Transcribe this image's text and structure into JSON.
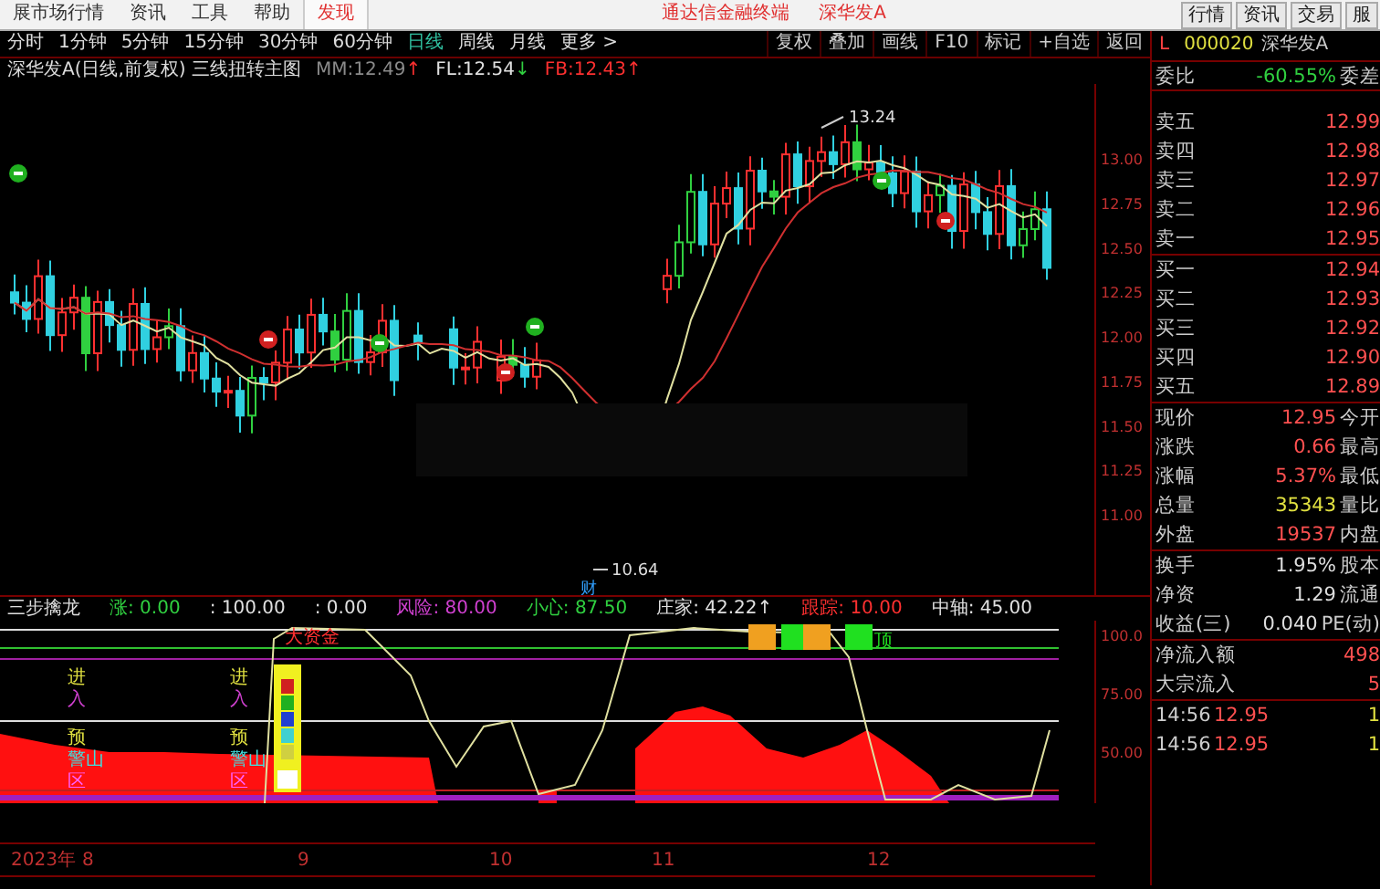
{
  "menu": {
    "items": [
      {
        "label": "展市场行情",
        "selected": false
      },
      {
        "label": "资讯",
        "selected": false
      },
      {
        "label": "工具",
        "selected": false
      },
      {
        "label": "帮助",
        "selected": false
      },
      {
        "label": "发现",
        "selected": true
      }
    ],
    "app_title": "通达信金融终端",
    "stock_title": "深华发A",
    "right_buttons": [
      "行情",
      "资讯",
      "交易",
      "服"
    ]
  },
  "periods": [
    {
      "label": "分时",
      "selected": false
    },
    {
      "label": "1分钟",
      "selected": false
    },
    {
      "label": "5分钟",
      "selected": false
    },
    {
      "label": "15分钟",
      "selected": false
    },
    {
      "label": "30分钟",
      "selected": false
    },
    {
      "label": "60分钟",
      "selected": false
    },
    {
      "label": "日线",
      "selected": true
    },
    {
      "label": "周线",
      "selected": false
    },
    {
      "label": "月线",
      "selected": false
    },
    {
      "label": "更多 >",
      "selected": false
    }
  ],
  "toolbar": [
    "复权",
    "叠加",
    "画线",
    "F10",
    "标记",
    "+自选",
    "返回"
  ],
  "main_chart": {
    "title": "深华发A(日线,前复权) 三线扭转主图",
    "indicators": [
      {
        "text": "MM:12.49",
        "arrow": "↑",
        "color": "#8a8a8a",
        "rising": true
      },
      {
        "text": "FL:12.54",
        "arrow": "↓",
        "color": "#e0e0e0",
        "rising": false
      },
      {
        "text": "FB:12.43",
        "arrow": "↑",
        "color": "#ff3030",
        "rising": true
      }
    ],
    "high_label": "13.24",
    "low_label": "10.64",
    "event_mark": "财",
    "price_axis": [
      "13.00",
      "12.75",
      "12.50",
      "12.25",
      "12.00",
      "11.75",
      "11.50",
      "11.25",
      "11.00"
    ]
  },
  "indicator": {
    "name": "三步擒龙",
    "values": [
      {
        "text": "涨: 0.00",
        "color": "#30d040"
      },
      {
        "text": ": 100.00",
        "color": "#e0e0e0"
      },
      {
        "text": ": 0.00",
        "color": "#e0e0e0"
      },
      {
        "text": "风险: 80.00",
        "color": "#d040d0"
      },
      {
        "text": "小心: 87.50",
        "color": "#30d040"
      },
      {
        "text": "庄家: 42.22↑",
        "color": "#e0e0e0"
      },
      {
        "text": "跟踪: 10.00",
        "color": "#ff3030"
      },
      {
        "text": "中轴: 45.00",
        "color": "#e0e0e0"
      }
    ],
    "signal_columns": [
      [
        {
          "text": "进",
          "color": "#e0e040"
        },
        {
          "text": "入",
          "color": "#d040d0"
        },
        {
          "text": "预",
          "color": "#e0e040"
        },
        {
          "text": "警山",
          "color": "#40e0e0"
        },
        {
          "text": "区",
          "color": "#ff60ff"
        }
      ],
      [
        {
          "text": "进",
          "color": "#e0e040"
        },
        {
          "text": "入",
          "color": "#d040d0"
        },
        {
          "text": "预",
          "color": "#e0e040"
        },
        {
          "text": "警山",
          "color": "#40e0e0"
        },
        {
          "text": "区",
          "color": "#ff60ff"
        }
      ]
    ],
    "big_money_label": "大资金",
    "top_label": "顶",
    "axis": [
      "100.0",
      "75.00",
      "50.00"
    ]
  },
  "time_axis": [
    "2023年",
    "8",
    "9",
    "10",
    "11",
    "12"
  ],
  "quote": {
    "marker": "L",
    "code": "000020",
    "name": "深华发A",
    "ratio": {
      "label": "委比",
      "value": "-60.55%",
      "label2": "委差"
    },
    "sells": [
      {
        "label": "卖五",
        "price": "12.99"
      },
      {
        "label": "卖四",
        "price": "12.98"
      },
      {
        "label": "卖三",
        "price": "12.97"
      },
      {
        "label": "卖二",
        "price": "12.96"
      },
      {
        "label": "卖一",
        "price": "12.95"
      }
    ],
    "buys": [
      {
        "label": "买一",
        "price": "12.94"
      },
      {
        "label": "买二",
        "price": "12.93"
      },
      {
        "label": "买三",
        "price": "12.92"
      },
      {
        "label": "买四",
        "price": "12.90"
      },
      {
        "label": "买五",
        "price": "12.89"
      }
    ],
    "stats": [
      {
        "label": "现价",
        "value": "12.95",
        "label2": "今开",
        "color": "#ff5050"
      },
      {
        "label": "涨跌",
        "value": "0.66",
        "label2": "最高",
        "color": "#ff5050"
      },
      {
        "label": "涨幅",
        "value": "5.37%",
        "label2": "最低",
        "color": "#ff5050"
      },
      {
        "label": "总量",
        "value": "35343",
        "label2": "量比",
        "color": "#e0e040"
      },
      {
        "label": "外盘",
        "value": "19537",
        "label2": "内盘",
        "color": "#ff5050"
      }
    ],
    "stats2": [
      {
        "label": "换手",
        "value": "1.95%",
        "label2": "股本"
      },
      {
        "label": "净资",
        "value": "1.29",
        "label2": "流通"
      },
      {
        "label": "收益(三)",
        "value": "0.040",
        "label2": "PE(动)"
      }
    ],
    "flows": [
      {
        "label": "净流入额",
        "value": "498"
      },
      {
        "label": "大宗流入",
        "value": "5"
      }
    ],
    "ticks": [
      {
        "time": "14:56",
        "price": "12.95",
        "volume": "1"
      },
      {
        "time": "14:56",
        "price": "12.95",
        "volume": "1"
      }
    ]
  }
}
